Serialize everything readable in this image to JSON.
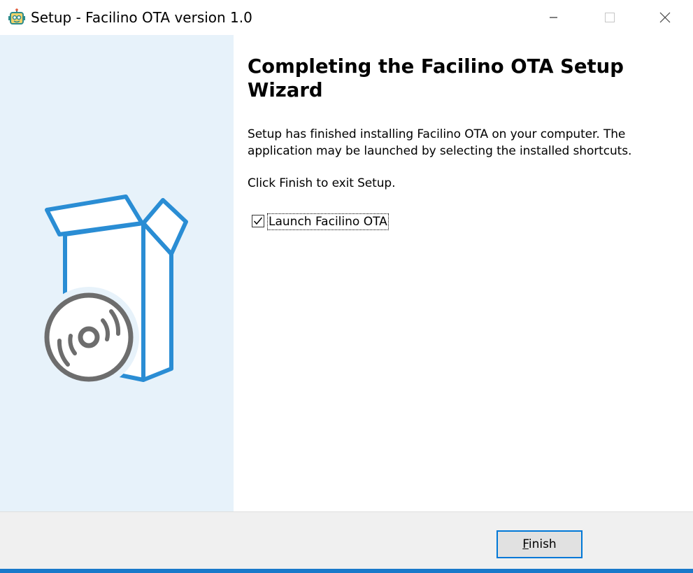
{
  "window": {
    "title": "Setup - Facilino OTA version 1.0",
    "icon": "facilino-robot-icon",
    "controls": [
      "minimize-icon",
      "maximize-icon",
      "close-icon"
    ]
  },
  "sidebar": {
    "background": "#e7f2fa",
    "artwork": "open-box-with-disc-icon",
    "accent": "#2a8dd4",
    "disc_color": "#6d6d6d"
  },
  "main": {
    "heading": "Completing the Facilino OTA Setup Wizard",
    "paragraph1": "Setup has finished installing Facilino OTA on your computer. The application may be launched by selecting the installed shortcuts.",
    "paragraph2": "Click Finish to exit Setup.",
    "launch_checkbox": {
      "label": "Launch Facilino OTA",
      "checked": true
    }
  },
  "footer": {
    "finish_label": "Finish",
    "finish_accesskey": "F",
    "accent": "#0078d7"
  }
}
